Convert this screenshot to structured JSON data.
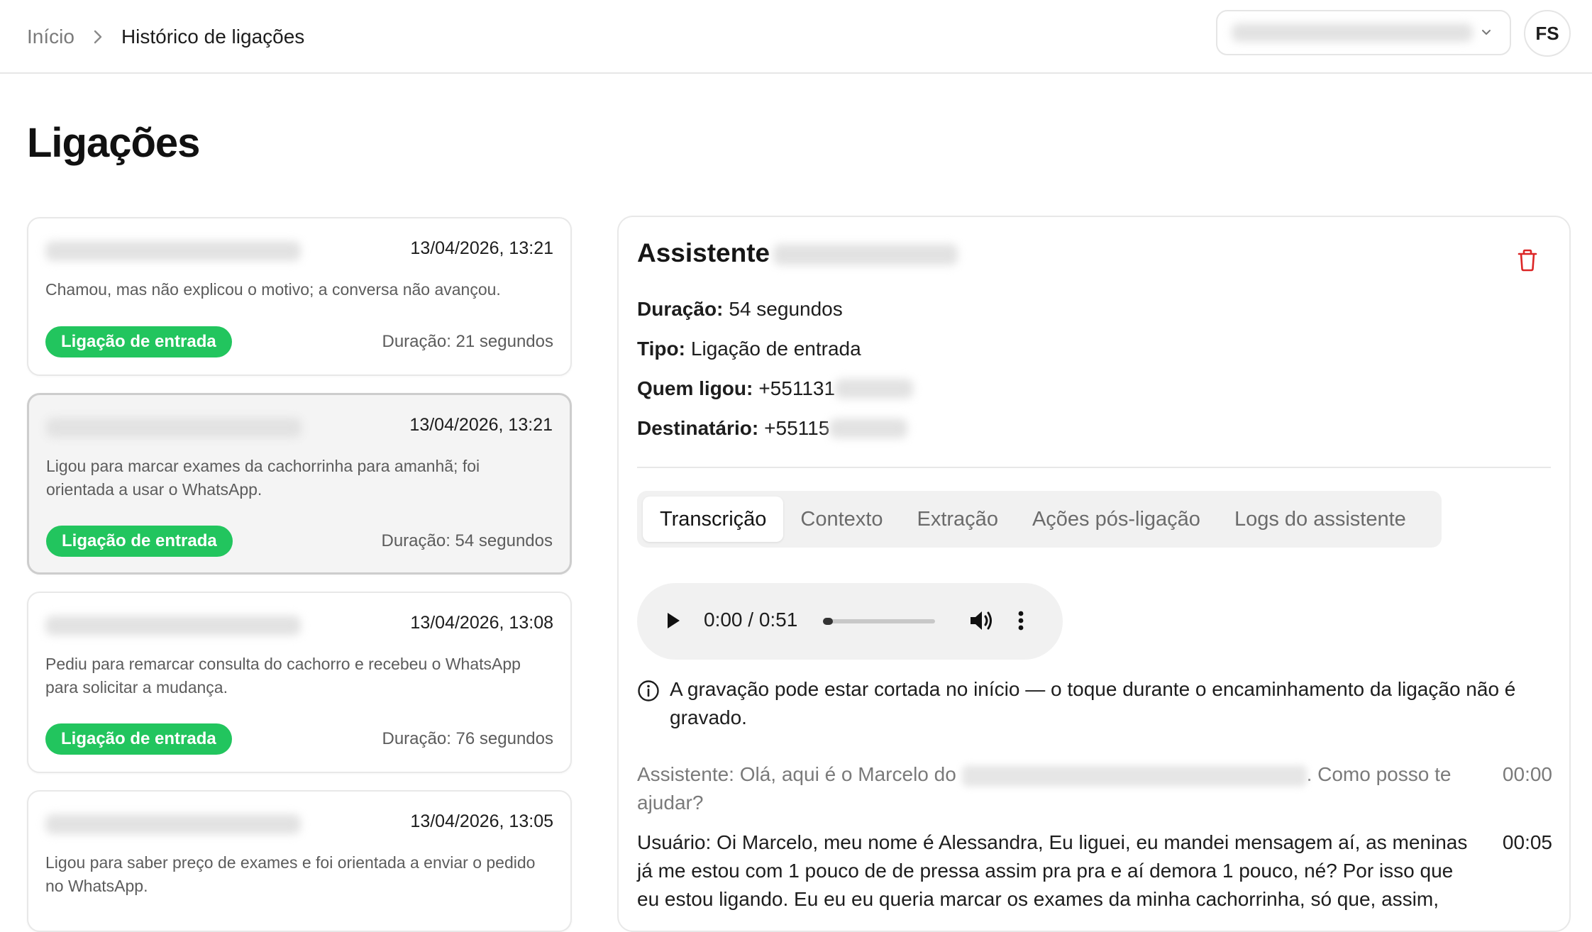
{
  "breadcrumb": {
    "home": "Início",
    "current": "Histórico de ligações"
  },
  "user": {
    "initials": "FS"
  },
  "page": {
    "title": "Ligações"
  },
  "calls": [
    {
      "datetime": "13/04/2026, 13:21",
      "summary": "Chamou, mas não explicou o motivo; a conversa não avançou.",
      "type": "Ligação de entrada",
      "duration": "Duração: 21 segundos"
    },
    {
      "datetime": "13/04/2026, 13:21",
      "summary": "Ligou para marcar exames da cachorrinha para amanhã; foi orientada a usar o WhatsApp.",
      "type": "Ligação de entrada",
      "duration": "Duração: 54 segundos"
    },
    {
      "datetime": "13/04/2026, 13:08",
      "summary": "Pediu para remarcar consulta do cachorro e recebeu o WhatsApp para solicitar a mudança.",
      "type": "Ligação de entrada",
      "duration": "Duração: 76 segundos"
    },
    {
      "datetime": "13/04/2026, 13:05",
      "summary": "Ligou para saber preço de exames e foi orientada a enviar o pedido no WhatsApp.",
      "type": "",
      "duration": ""
    }
  ],
  "detail": {
    "title": "Assistente",
    "duration_label": "Duração:",
    "duration_value": "54 segundos",
    "type_label": "Tipo:",
    "type_value": "Ligação de entrada",
    "caller_label": "Quem ligou:",
    "caller_value": "+551131",
    "recipient_label": "Destinatário:",
    "recipient_value": "+55115"
  },
  "tabs": [
    "Transcrição",
    "Contexto",
    "Extração",
    "Ações pós-ligação",
    "Logs do assistente"
  ],
  "active_tab": "Transcrição",
  "audio": {
    "time": "0:00 / 0:51",
    "progress": 0
  },
  "notice": "A gravação pode estar cortada no início — o toque durante o encaminhamento da ligação não é gravado.",
  "transcript": [
    {
      "speaker": "assistant",
      "text_before": "Assistente: Olá, aqui é o Marcelo do ",
      "text_after": ". Como posso te ajudar?",
      "time": "00:00"
    },
    {
      "speaker": "user",
      "text": "Usuário: Oi Marcelo, meu nome é Alessandra, Eu liguei, eu mandei mensagem aí, as meninas já me estou com 1 pouco de de pressa assim pra pra e aí demora 1 pouco, né? Por isso que eu estou ligando. Eu eu eu queria marcar os exames da minha cachorrinha, só que, assim,",
      "time": "00:05"
    }
  ],
  "colors": {
    "badge": "#22c55e",
    "trash": "#dc2626"
  }
}
